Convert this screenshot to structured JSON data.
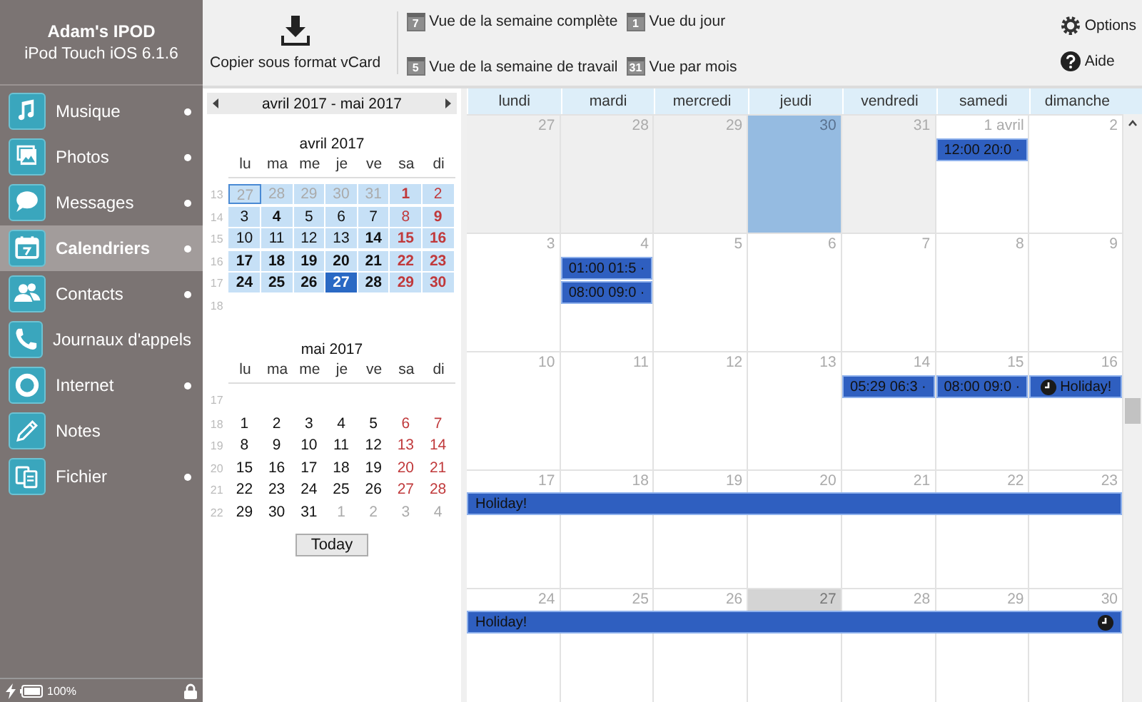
{
  "device": {
    "name": "Adam's IPOD",
    "model": "iPod Touch iOS 6.1.6"
  },
  "sidebar": {
    "items": [
      {
        "label": "Musique",
        "selected": false,
        "dot": true
      },
      {
        "label": "Photos",
        "selected": false,
        "dot": true
      },
      {
        "label": "Messages",
        "selected": false,
        "dot": true
      },
      {
        "label": "Calendriers",
        "selected": true,
        "dot": true
      },
      {
        "label": "Contacts",
        "selected": false,
        "dot": true
      },
      {
        "label": "Journaux d'appels",
        "selected": false,
        "dot": false
      },
      {
        "label": "Internet",
        "selected": false,
        "dot": true
      },
      {
        "label": "Notes",
        "selected": false,
        "dot": false
      },
      {
        "label": "Fichier",
        "selected": false,
        "dot": true
      }
    ],
    "status": {
      "battery": "100%"
    }
  },
  "toolbar": {
    "export": "Copier sous format vCard",
    "views": [
      {
        "icon_text": "7",
        "label": "Vue de la semaine complète"
      },
      {
        "icon_text": "5",
        "label": "Vue de la semaine de travail"
      },
      {
        "icon_text": "1",
        "label": "Vue du jour"
      },
      {
        "icon_text": "31",
        "label": "Vue par mois"
      }
    ],
    "options": "Options",
    "help": "Aide"
  },
  "mini_calendar": {
    "range": "avril 2017 - mai 2017",
    "today_button": "Today",
    "months": [
      {
        "title": "avril 2017",
        "weekdays": [
          "lu",
          "ma",
          "me",
          "je",
          "ve",
          "sa",
          "di"
        ],
        "weeks": [
          {
            "number": "13",
            "highlighted": true,
            "days": [
              {
                "d": "27",
                "kind": "other",
                "bold": false,
                "selected": false,
                "focused": true
              },
              {
                "d": "28",
                "kind": "other",
                "bold": false,
                "selected": false,
                "focused": false
              },
              {
                "d": "29",
                "kind": "other",
                "bold": false,
                "selected": false,
                "focused": false
              },
              {
                "d": "30",
                "kind": "other",
                "bold": false,
                "selected": false,
                "focused": false
              },
              {
                "d": "31",
                "kind": "other",
                "bold": false,
                "selected": false,
                "focused": false
              },
              {
                "d": "1",
                "kind": "weekend",
                "bold": true,
                "selected": false,
                "focused": false
              },
              {
                "d": "2",
                "kind": "weekend",
                "bold": false,
                "selected": false,
                "focused": false
              }
            ]
          },
          {
            "number": "14",
            "highlighted": true,
            "days": [
              {
                "d": "3",
                "kind": "day",
                "bold": false,
                "selected": false,
                "focused": false
              },
              {
                "d": "4",
                "kind": "day",
                "bold": true,
                "selected": false,
                "focused": false
              },
              {
                "d": "5",
                "kind": "day",
                "bold": false,
                "selected": false,
                "focused": false
              },
              {
                "d": "6",
                "kind": "day",
                "bold": false,
                "selected": false,
                "focused": false
              },
              {
                "d": "7",
                "kind": "day",
                "bold": false,
                "selected": false,
                "focused": false
              },
              {
                "d": "8",
                "kind": "weekend",
                "bold": false,
                "selected": false,
                "focused": false
              },
              {
                "d": "9",
                "kind": "weekend",
                "bold": true,
                "selected": false,
                "focused": false
              }
            ]
          },
          {
            "number": "15",
            "highlighted": true,
            "days": [
              {
                "d": "10",
                "kind": "day",
                "bold": false,
                "selected": false,
                "focused": false
              },
              {
                "d": "11",
                "kind": "day",
                "bold": false,
                "selected": false,
                "focused": false
              },
              {
                "d": "12",
                "kind": "day",
                "bold": false,
                "selected": false,
                "focused": false
              },
              {
                "d": "13",
                "kind": "day",
                "bold": false,
                "selected": false,
                "focused": false
              },
              {
                "d": "14",
                "kind": "day",
                "bold": true,
                "selected": false,
                "focused": false
              },
              {
                "d": "15",
                "kind": "weekend",
                "bold": true,
                "selected": false,
                "focused": false
              },
              {
                "d": "16",
                "kind": "weekend",
                "bold": true,
                "selected": false,
                "focused": false
              }
            ]
          },
          {
            "number": "16",
            "highlighted": true,
            "days": [
              {
                "d": "17",
                "kind": "day",
                "bold": true,
                "selected": false,
                "focused": false
              },
              {
                "d": "18",
                "kind": "day",
                "bold": true,
                "selected": false,
                "focused": false
              },
              {
                "d": "19",
                "kind": "day",
                "bold": true,
                "selected": false,
                "focused": false
              },
              {
                "d": "20",
                "kind": "day",
                "bold": true,
                "selected": false,
                "focused": false
              },
              {
                "d": "21",
                "kind": "day",
                "bold": true,
                "selected": false,
                "focused": false
              },
              {
                "d": "22",
                "kind": "weekend",
                "bold": true,
                "selected": false,
                "focused": false
              },
              {
                "d": "23",
                "kind": "weekend",
                "bold": true,
                "selected": false,
                "focused": false
              }
            ]
          },
          {
            "number": "17",
            "highlighted": true,
            "days": [
              {
                "d": "24",
                "kind": "day",
                "bold": true,
                "selected": false,
                "focused": false
              },
              {
                "d": "25",
                "kind": "day",
                "bold": true,
                "selected": false,
                "focused": false
              },
              {
                "d": "26",
                "kind": "day",
                "bold": true,
                "selected": false,
                "focused": false
              },
              {
                "d": "27",
                "kind": "day",
                "bold": true,
                "selected": true,
                "focused": false
              },
              {
                "d": "28",
                "kind": "day",
                "bold": true,
                "selected": false,
                "focused": false
              },
              {
                "d": "29",
                "kind": "weekend",
                "bold": true,
                "selected": false,
                "focused": false
              },
              {
                "d": "30",
                "kind": "weekend",
                "bold": true,
                "selected": false,
                "focused": false
              }
            ]
          },
          {
            "number": "18",
            "highlighted": false
          }
        ]
      },
      {
        "title": "mai 2017",
        "weekdays": [
          "lu",
          "ma",
          "me",
          "je",
          "ve",
          "sa",
          "di"
        ],
        "weeks": [
          {
            "number": "17",
            "highlighted": false
          },
          {
            "number": "18",
            "highlighted": false,
            "days": [
              {
                "d": "1",
                "kind": "day",
                "bold": false,
                "selected": false,
                "focused": false
              },
              {
                "d": "2",
                "kind": "day",
                "bold": false,
                "selected": false,
                "focused": false
              },
              {
                "d": "3",
                "kind": "day",
                "bold": false,
                "selected": false,
                "focused": false
              },
              {
                "d": "4",
                "kind": "day",
                "bold": false,
                "selected": false,
                "focused": false
              },
              {
                "d": "5",
                "kind": "day",
                "bold": false,
                "selected": false,
                "focused": false
              },
              {
                "d": "6",
                "kind": "weekend",
                "bold": false,
                "selected": false,
                "focused": false
              },
              {
                "d": "7",
                "kind": "weekend",
                "bold": false,
                "selected": false,
                "focused": false
              }
            ]
          },
          {
            "number": "19",
            "highlighted": false,
            "days": [
              {
                "d": "8",
                "kind": "day",
                "bold": false,
                "selected": false,
                "focused": false
              },
              {
                "d": "9",
                "kind": "day",
                "bold": false,
                "selected": false,
                "focused": false
              },
              {
                "d": "10",
                "kind": "day",
                "bold": false,
                "selected": false,
                "focused": false
              },
              {
                "d": "11",
                "kind": "day",
                "bold": false,
                "selected": false,
                "focused": false
              },
              {
                "d": "12",
                "kind": "day",
                "bold": false,
                "selected": false,
                "focused": false
              },
              {
                "d": "13",
                "kind": "weekend",
                "bold": false,
                "selected": false,
                "focused": false
              },
              {
                "d": "14",
                "kind": "weekend",
                "bold": false,
                "selected": false,
                "focused": false
              }
            ]
          },
          {
            "number": "20",
            "highlighted": false,
            "days": [
              {
                "d": "15",
                "kind": "day",
                "bold": false,
                "selected": false,
                "focused": false
              },
              {
                "d": "16",
                "kind": "day",
                "bold": false,
                "selected": false,
                "focused": false
              },
              {
                "d": "17",
                "kind": "day",
                "bold": false,
                "selected": false,
                "focused": false
              },
              {
                "d": "18",
                "kind": "day",
                "bold": false,
                "selected": false,
                "focused": false
              },
              {
                "d": "19",
                "kind": "day",
                "bold": false,
                "selected": false,
                "focused": false
              },
              {
                "d": "20",
                "kind": "weekend",
                "bold": false,
                "selected": false,
                "focused": false
              },
              {
                "d": "21",
                "kind": "weekend",
                "bold": false,
                "selected": false,
                "focused": false
              }
            ]
          },
          {
            "number": "21",
            "highlighted": false,
            "days": [
              {
                "d": "22",
                "kind": "day",
                "bold": false,
                "selected": false,
                "focused": false
              },
              {
                "d": "23",
                "kind": "day",
                "bold": false,
                "selected": false,
                "focused": false
              },
              {
                "d": "24",
                "kind": "day",
                "bold": false,
                "selected": false,
                "focused": false
              },
              {
                "d": "25",
                "kind": "day",
                "bold": false,
                "selected": false,
                "focused": false
              },
              {
                "d": "26",
                "kind": "day",
                "bold": false,
                "selected": false,
                "focused": false
              },
              {
                "d": "27",
                "kind": "weekend",
                "bold": false,
                "selected": false,
                "focused": false
              },
              {
                "d": "28",
                "kind": "weekend",
                "bold": false,
                "selected": false,
                "focused": false
              }
            ]
          },
          {
            "number": "22",
            "highlighted": false,
            "days": [
              {
                "d": "29",
                "kind": "day",
                "bold": false,
                "selected": false,
                "focused": false
              },
              {
                "d": "30",
                "kind": "day",
                "bold": false,
                "selected": false,
                "focused": false
              },
              {
                "d": "31",
                "kind": "day",
                "bold": false,
                "selected": false,
                "focused": false
              },
              {
                "d": "1",
                "kind": "other",
                "bold": false,
                "selected": false,
                "focused": false
              },
              {
                "d": "2",
                "kind": "other",
                "bold": false,
                "selected": false,
                "focused": false
              },
              {
                "d": "3",
                "kind": "other",
                "bold": false,
                "selected": false,
                "focused": false
              },
              {
                "d": "4",
                "kind": "other",
                "bold": false,
                "selected": false,
                "focused": false
              }
            ]
          }
        ]
      }
    ]
  },
  "month_view": {
    "weekdays": [
      "lundi",
      "mardi",
      "mercredi",
      "jeudi",
      "vendredi",
      "samedi",
      "dimanche"
    ],
    "weeks": [
      {
        "days": [
          {
            "label": "27",
            "kind": "other",
            "selected": false,
            "today": false
          },
          {
            "label": "28",
            "kind": "other",
            "selected": false,
            "today": false
          },
          {
            "label": "29",
            "kind": "other",
            "selected": false,
            "today": false
          },
          {
            "label": "30",
            "kind": "other",
            "selected": true,
            "today": false
          },
          {
            "label": "31",
            "kind": "other",
            "selected": false,
            "today": false
          },
          {
            "label": "1 avril",
            "kind": "current",
            "selected": false,
            "today": false,
            "events": [
              {
                "text": "12:00 20:0 ·",
                "clock": false
              }
            ]
          },
          {
            "label": "2",
            "kind": "current",
            "selected": false,
            "today": false
          }
        ]
      },
      {
        "days": [
          {
            "label": "3",
            "kind": "current",
            "selected": false,
            "today": false
          },
          {
            "label": "4",
            "kind": "current",
            "selected": false,
            "today": false,
            "events": [
              {
                "text": "01:00 01:5 ·",
                "clock": false
              },
              {
                "text": "08:00 09:0 ·",
                "clock": false
              }
            ]
          },
          {
            "label": "5",
            "kind": "current",
            "selected": false,
            "today": false
          },
          {
            "label": "6",
            "kind": "current",
            "selected": false,
            "today": false
          },
          {
            "label": "7",
            "kind": "current",
            "selected": false,
            "today": false
          },
          {
            "label": "8",
            "kind": "current",
            "selected": false,
            "today": false
          },
          {
            "label": "9",
            "kind": "current",
            "selected": false,
            "today": false
          }
        ]
      },
      {
        "days": [
          {
            "label": "10",
            "kind": "current",
            "selected": false,
            "today": false
          },
          {
            "label": "11",
            "kind": "current",
            "selected": false,
            "today": false
          },
          {
            "label": "12",
            "kind": "current",
            "selected": false,
            "today": false
          },
          {
            "label": "13",
            "kind": "current",
            "selected": false,
            "today": false
          },
          {
            "label": "14",
            "kind": "current",
            "selected": false,
            "today": false,
            "events": [
              {
                "text": "05:29 06:3 ·",
                "clock": false
              }
            ]
          },
          {
            "label": "15",
            "kind": "current",
            "selected": false,
            "today": false,
            "events": [
              {
                "text": "08:00 09:0 ·",
                "clock": false
              }
            ]
          },
          {
            "label": "16",
            "kind": "current",
            "selected": false,
            "today": false,
            "events": [
              {
                "text": "Holiday!",
                "clock": true
              }
            ]
          }
        ]
      },
      {
        "banners": [
          {
            "text": "Holiday!",
            "clock": false
          }
        ],
        "days": [
          {
            "label": "17",
            "kind": "current",
            "selected": false,
            "today": false
          },
          {
            "label": "18",
            "kind": "current",
            "selected": false,
            "today": false
          },
          {
            "label": "19",
            "kind": "current",
            "selected": false,
            "today": false
          },
          {
            "label": "20",
            "kind": "current",
            "selected": false,
            "today": false
          },
          {
            "label": "21",
            "kind": "current",
            "selected": false,
            "today": false
          },
          {
            "label": "22",
            "kind": "current",
            "selected": false,
            "today": false
          },
          {
            "label": "23",
            "kind": "current",
            "selected": false,
            "today": false
          }
        ]
      },
      {
        "banners": [
          {
            "text": "Holiday!",
            "clock": true
          }
        ],
        "days": [
          {
            "label": "24",
            "kind": "current",
            "selected": false,
            "today": false
          },
          {
            "label": "25",
            "kind": "current",
            "selected": false,
            "today": false
          },
          {
            "label": "26",
            "kind": "current",
            "selected": false,
            "today": false
          },
          {
            "label": "27",
            "kind": "current",
            "selected": false,
            "today": true
          },
          {
            "label": "28",
            "kind": "current",
            "selected": false,
            "today": false
          },
          {
            "label": "29",
            "kind": "current",
            "selected": false,
            "today": false
          },
          {
            "label": "30",
            "kind": "current",
            "selected": false,
            "today": false
          }
        ]
      }
    ]
  }
}
